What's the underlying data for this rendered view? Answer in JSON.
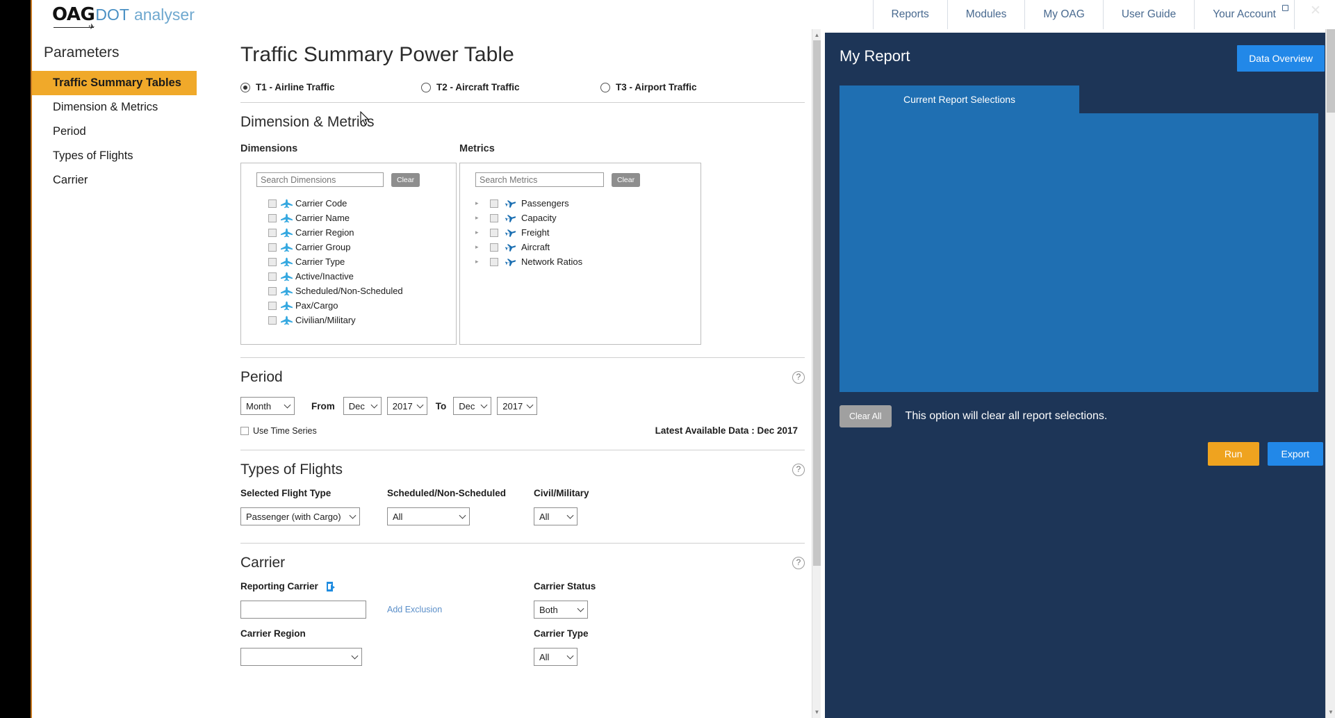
{
  "window": {
    "close_label": "✕"
  },
  "brand": {
    "oag": "OAG",
    "dot": "DOT",
    "analyser": "analyser",
    "plane_glyph": "✈"
  },
  "nav": {
    "items": [
      {
        "label": "Reports",
        "external": false
      },
      {
        "label": "Modules",
        "external": false
      },
      {
        "label": "My OAG",
        "external": false
      },
      {
        "label": "User Guide",
        "external": false
      },
      {
        "label": "Your Account",
        "external": true
      }
    ]
  },
  "sidebar": {
    "title": "Parameters",
    "items": [
      {
        "label": "Traffic Summary Tables",
        "active": true
      },
      {
        "label": "Dimension & Metrics",
        "active": false
      },
      {
        "label": "Period",
        "active": false
      },
      {
        "label": "Types of Flights",
        "active": false
      },
      {
        "label": "Carrier",
        "active": false
      }
    ]
  },
  "main": {
    "page_title": "Traffic Summary Power Table",
    "table_options": [
      {
        "label": "T1 - Airline Traffic",
        "selected": true
      },
      {
        "label": "T2 - Aircraft Traffic",
        "selected": false
      },
      {
        "label": "T3 - Airport Traffic",
        "selected": false
      }
    ],
    "dimension_metrics": {
      "heading": "Dimension & Metrics",
      "dimensions": {
        "column_label": "Dimensions",
        "search_placeholder": "Search Dimensions",
        "clear_label": "Clear",
        "items": [
          {
            "label": "Carrier Code",
            "checked": false
          },
          {
            "label": "Carrier Name",
            "checked": false
          },
          {
            "label": "Carrier Region",
            "checked": false
          },
          {
            "label": "Carrier Group",
            "checked": false
          },
          {
            "label": "Carrier Type",
            "checked": false
          },
          {
            "label": "Active/Inactive",
            "checked": false
          },
          {
            "label": "Scheduled/Non-Scheduled",
            "checked": false
          },
          {
            "label": "Pax/Cargo",
            "checked": false
          },
          {
            "label": "Civilian/Military",
            "checked": false
          }
        ]
      },
      "metrics": {
        "column_label": "Metrics",
        "search_placeholder": "Search Metrics",
        "clear_label": "Clear",
        "items": [
          {
            "label": "Passengers",
            "checked": false,
            "expandable": true
          },
          {
            "label": "Capacity",
            "checked": false,
            "expandable": true
          },
          {
            "label": "Freight",
            "checked": false,
            "expandable": true
          },
          {
            "label": "Aircraft",
            "checked": false,
            "expandable": true
          },
          {
            "label": "Network Ratios",
            "checked": false,
            "expandable": true
          }
        ]
      }
    },
    "period": {
      "heading": "Period",
      "help_label": "?",
      "granularity": "Month",
      "from_label": "From",
      "from_month": "Dec",
      "from_year": "2017",
      "to_label": "To",
      "to_month": "Dec",
      "to_year": "2017",
      "time_series_label": "Use Time Series",
      "time_series_checked": false,
      "latest_available": "Latest Available Data : Dec 2017"
    },
    "types_of_flights": {
      "heading": "Types of Flights",
      "help_label": "?",
      "selected_flight_type_label": "Selected Flight Type",
      "selected_flight_type_value": "Passenger (with Cargo)",
      "scheduled_label": "Scheduled/Non-Scheduled",
      "scheduled_value": "All",
      "civil_military_label": "Civil/Military",
      "civil_military_value": "All"
    },
    "carrier": {
      "heading": "Carrier",
      "help_label": "?",
      "reporting_carrier_label": "Reporting Carrier",
      "reporting_carrier_value": "",
      "add_exclusion_label": "Add Exclusion",
      "carrier_region_label": "Carrier Region",
      "carrier_region_value": "",
      "carrier_status_label": "Carrier Status",
      "carrier_status_value": "Both",
      "carrier_type_label": "Carrier Type",
      "carrier_type_value": "All"
    }
  },
  "report": {
    "title": "My Report",
    "data_overview_label": "Data Overview",
    "tab_label": "Current Report Selections",
    "clear_all_label": "Clear All",
    "clear_message": "This option will clear all report selections.",
    "run_label": "Run",
    "export_label": "Export"
  },
  "colors": {
    "accent_orange": "#f0a92a",
    "nav_blue": "#48698f",
    "report_navy": "#1d3557",
    "report_panel_blue": "#1f6fb2",
    "button_blue": "#2288e8",
    "run_orange": "#efa31f"
  }
}
